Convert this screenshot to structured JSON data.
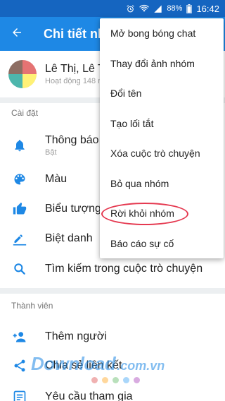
{
  "status_bar": {
    "battery_percent": "88%",
    "time": "16:42",
    "icons": [
      "alarm-icon",
      "wifi-icon",
      "signal-icon",
      "battery-icon"
    ]
  },
  "app_bar": {
    "title": "Chi tiết nh",
    "back_icon": "arrow-back-icon"
  },
  "group": {
    "name": "Lê Thị, Lê T",
    "status": "Hoạt động 148 n"
  },
  "settings": {
    "header": "Cài đặt",
    "items": [
      {
        "label": "Thông báo",
        "sub": "Bật",
        "icon": "bell-icon"
      },
      {
        "label": "Màu",
        "icon": "palette-icon"
      },
      {
        "label": "Biểu tượng",
        "icon": "thumbs-up-icon"
      },
      {
        "label": "Biệt danh",
        "icon": "pencil-icon"
      },
      {
        "label": "Tìm kiếm trong cuộc trò chuyện",
        "icon": "search-icon"
      }
    ]
  },
  "members": {
    "header": "Thành viên",
    "items": [
      {
        "label": "Thêm người",
        "icon": "add-person-icon"
      },
      {
        "label": "Chia sẻ liên kết",
        "icon": "share-icon"
      },
      {
        "label": "Yêu cầu tham gia",
        "icon": "requests-icon"
      }
    ]
  },
  "menu": {
    "items": [
      "Mở bong bóng chat",
      "Thay đổi ảnh nhóm",
      "Đổi tên",
      "Tạo lối tắt",
      "Xóa cuộc trò chuyện",
      "Bỏ qua nhóm",
      "Rời khỏi nhóm",
      "Báo cáo sự cố"
    ],
    "highlighted_index": 6
  },
  "watermark": {
    "main": "Download",
    "domain": ".com.vn"
  },
  "colors": {
    "status_bar": "#1565c0",
    "app_bar": "#1e88e5",
    "icon_blue": "#1e88e5",
    "highlight": "#e53950"
  }
}
